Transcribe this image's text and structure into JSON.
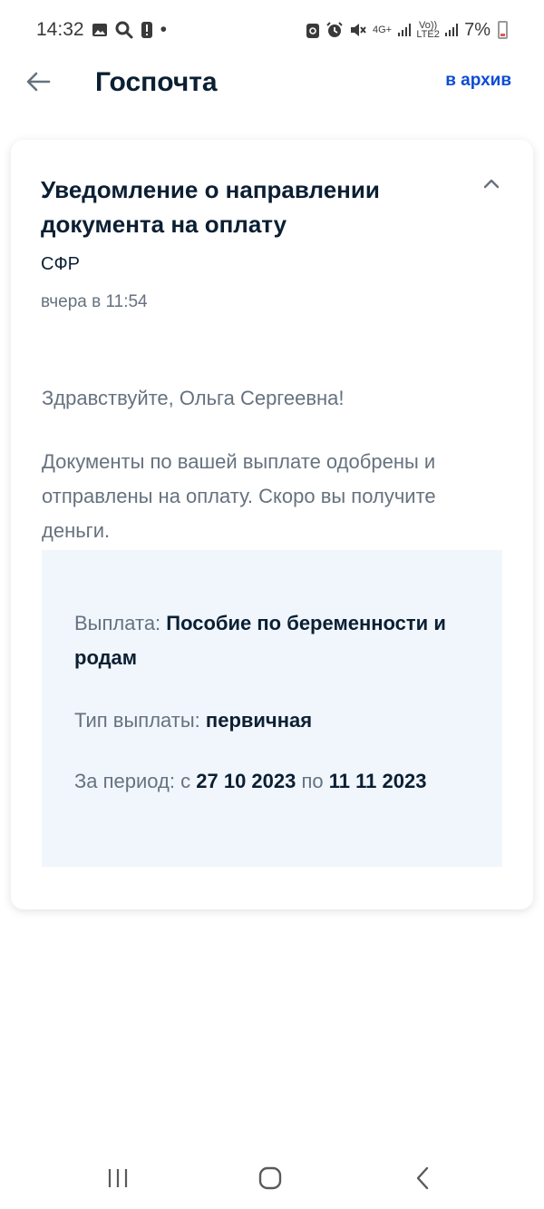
{
  "status_bar": {
    "time": "14:32",
    "dot": "•",
    "network_label": "4G+",
    "volte_label": "Vo)) LTE2",
    "battery_percent": "7%"
  },
  "header": {
    "title": "Госпочта",
    "archive_label": "в архив"
  },
  "message": {
    "title": "Уведомление о направлении документа на оплату",
    "sender": "СФР",
    "date": "вчера в 11:54",
    "greeting": "Здравствуйте, Ольга Сергеевна!",
    "body": "Документы по вашей выплате одобрены и отправлены на оплату. Скоро вы получите деньги.",
    "details": {
      "payment_label": "Выплата:",
      "payment_value": "Пособие по беременности и родам",
      "type_label": "Тип выплаты:",
      "type_value": "первичная",
      "period_label": "За период: с",
      "period_from": "27 10 2023",
      "period_to_label": "по",
      "period_to": "11 11 2023"
    }
  },
  "colors": {
    "accent": "#0d4cd3",
    "text": "#0b1f33",
    "muted": "#66727f",
    "info_bg": "#f1f6fd"
  }
}
